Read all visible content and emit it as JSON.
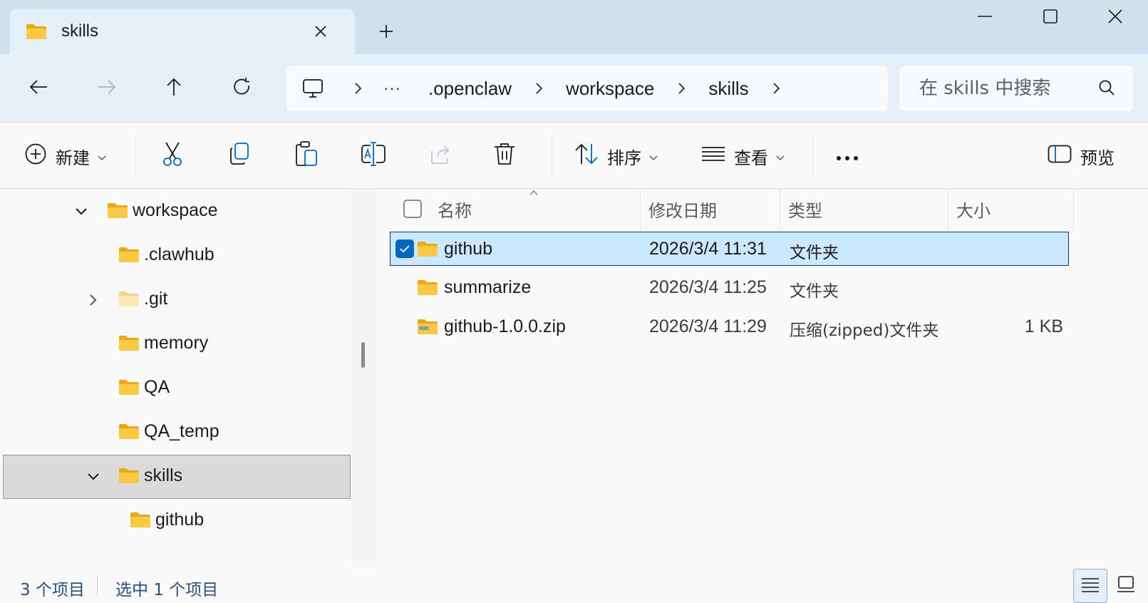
{
  "window": {
    "tab_title": "skills",
    "new_tab_label": "+",
    "minimize_icon": "minimize-icon",
    "maximize_icon": "maximize-icon",
    "close_icon": "close-icon"
  },
  "nav": {
    "back_icon": "arrow-left-icon",
    "forward_icon": "arrow-right-icon",
    "up_icon": "arrow-up-icon",
    "refresh_icon": "refresh-icon",
    "breadcrumb": {
      "root_icon": "computer-icon",
      "overflow": "···",
      "items": [
        ".openclaw",
        "workspace",
        "skills"
      ]
    },
    "search": {
      "placeholder": "在 skills 中搜索"
    }
  },
  "commandbar": {
    "new_label": "新建",
    "sort_label": "排序",
    "view_label": "查看",
    "more_label": "···",
    "preview_label": "预览",
    "icons": [
      "plus-circle-icon",
      "cut-icon",
      "copy-icon",
      "paste-icon",
      "rename-icon",
      "share-icon",
      "delete-icon",
      "sort-icon",
      "view-icon",
      "preview-pane-icon"
    ]
  },
  "tree": {
    "items": [
      {
        "label": "workspace",
        "expanded": true
      },
      {
        "label": ".clawhub"
      },
      {
        "label": ".git",
        "collapsed": true
      },
      {
        "label": "memory"
      },
      {
        "label": "QA"
      },
      {
        "label": "QA_temp"
      },
      {
        "label": "skills",
        "expanded": true,
        "selected": true
      },
      {
        "label": "github"
      }
    ]
  },
  "filelist": {
    "columns": {
      "name": "名称",
      "modified": "修改日期",
      "type": "类型",
      "size": "大小"
    },
    "rows": [
      {
        "name": "github",
        "modified": "2026/3/4 11:31",
        "type": "文件夹",
        "size": "",
        "selected": true,
        "icon": "folder-icon"
      },
      {
        "name": "summarize",
        "modified": "2026/3/4 11:25",
        "type": "文件夹",
        "size": "",
        "selected": false,
        "icon": "folder-icon"
      },
      {
        "name": "github-1.0.0.zip",
        "modified": "2026/3/4 11:29",
        "type": "压缩(zipped)文件夹",
        "size": "1 KB",
        "selected": false,
        "icon": "zip-folder-icon"
      }
    ]
  },
  "status": {
    "item_count": "3 个项目",
    "selected_count": "选中 1 个项目"
  },
  "colors": {
    "accent": "#0067c0",
    "selection_bg": "#cce8ff",
    "folder": "#f8c944"
  }
}
